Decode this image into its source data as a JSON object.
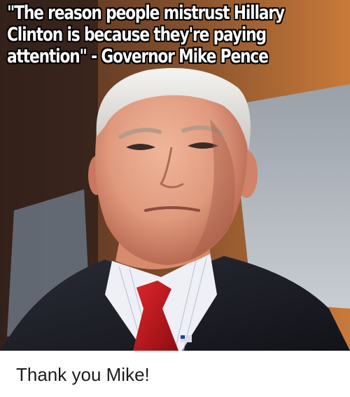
{
  "meme": {
    "caption": "\"The reason people mistrust Hillary Clinton is because they're paying attention\" - Governor Mike Pence",
    "photo_description_icon": "portrait-photo"
  },
  "footer": {
    "text": "Thank you Mike!"
  },
  "colors": {
    "caption_text": "#ffffff",
    "caption_outline": "#000000",
    "footer_text": "#1c1c1c",
    "tie": "#c0141a",
    "suit": "#1a1b22"
  }
}
